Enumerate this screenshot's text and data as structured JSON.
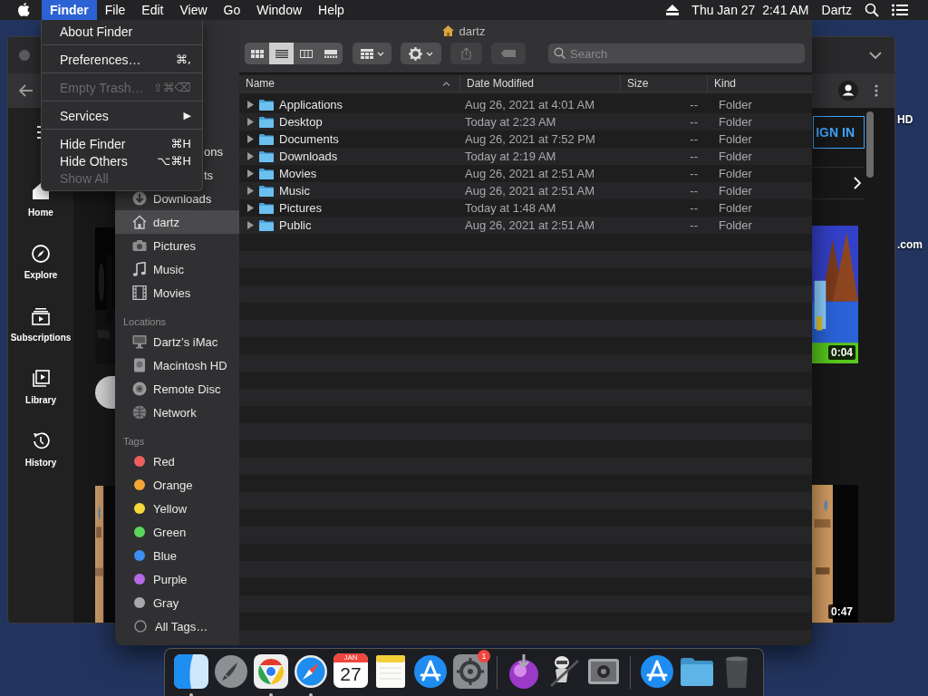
{
  "desktop": {
    "labels": [
      {
        "text": "HD"
      },
      {
        "text": ".com"
      }
    ]
  },
  "menu_bar": {
    "menus": [
      {
        "label": "Finder",
        "selected": true
      },
      {
        "label": "File",
        "selected": false
      },
      {
        "label": "Edit",
        "selected": false
      },
      {
        "label": "View",
        "selected": false
      },
      {
        "label": "Go",
        "selected": false
      },
      {
        "label": "Window",
        "selected": false
      },
      {
        "label": "Help",
        "selected": false
      }
    ],
    "clock": "Thu Jan 27  2:41 AM",
    "user": "Dartz"
  },
  "app_menu": {
    "items": [
      {
        "kind": "item",
        "label": "About Finder",
        "disabled": false
      },
      {
        "kind": "separator"
      },
      {
        "kind": "item",
        "label": "Preferences…",
        "shortcut": "⌘,",
        "disabled": false
      },
      {
        "kind": "separator"
      },
      {
        "kind": "item",
        "label": "Empty Trash…",
        "shortcut": "⇧⌘⌫",
        "disabled": true
      },
      {
        "kind": "separator"
      },
      {
        "kind": "submenu",
        "label": "Services",
        "arrow": "▶",
        "disabled": false
      },
      {
        "kind": "separator"
      },
      {
        "kind": "item",
        "label": "Hide Finder",
        "shortcut": "⌘H",
        "disabled": false
      },
      {
        "kind": "item",
        "label": "Hide Others",
        "shortcut": "⌥⌘H",
        "disabled": false
      },
      {
        "kind": "item",
        "label": "Show All",
        "disabled": true
      }
    ]
  },
  "browser": {
    "nav": [
      {
        "kind": "home",
        "label": "Home"
      },
      {
        "kind": "explore",
        "label": "Explore"
      },
      {
        "kind": "subscriptions",
        "label": "Subscriptions"
      },
      {
        "kind": "library",
        "label": "Library"
      },
      {
        "kind": "history",
        "label": "History"
      }
    ],
    "sign_in": "IGN IN",
    "videos": [
      {
        "kind": "picture",
        "duration": "0:04"
      },
      {
        "kind": "picture",
        "duration": "0:47"
      }
    ]
  },
  "finder": {
    "title": "dartz",
    "views": [
      {
        "kind": "icons",
        "selected": false
      },
      {
        "kind": "list",
        "selected": true
      },
      {
        "kind": "columns",
        "selected": false
      },
      {
        "kind": "gallery",
        "selected": false
      }
    ],
    "search": {
      "placeholder": "Search"
    },
    "sidebar": {
      "favorites": [
        {
          "kind": "clipped",
          "label": "ons",
          "selected": false
        },
        {
          "kind": "clipped",
          "label": "ts",
          "selected": false
        },
        {
          "kind": "downloads",
          "label": "Downloads",
          "selected": false
        },
        {
          "kind": "home",
          "label": "dartz",
          "selected": true
        },
        {
          "kind": "camera",
          "label": "Pictures",
          "selected": false
        },
        {
          "kind": "music",
          "label": "Music",
          "selected": false
        },
        {
          "kind": "film",
          "label": "Movies",
          "selected": false
        }
      ],
      "locations_heading": "Locations",
      "locations": [
        {
          "kind": "computer",
          "label": "Dartz’s iMac",
          "selected": false
        },
        {
          "kind": "disk",
          "label": "Macintosh HD",
          "selected": false
        },
        {
          "kind": "disc",
          "label": "Remote Disc",
          "selected": false
        },
        {
          "kind": "network",
          "label": "Network",
          "selected": false
        }
      ],
      "tags_heading": "Tags",
      "tags": [
        {
          "label": "Red",
          "color": "#ec5f5d"
        },
        {
          "label": "Orange",
          "color": "#f3a536"
        },
        {
          "label": "Yellow",
          "color": "#f5d83a"
        },
        {
          "label": "Green",
          "color": "#5cd65c"
        },
        {
          "label": "Blue",
          "color": "#3d8ef0"
        },
        {
          "label": "Purple",
          "color": "#b56be6"
        },
        {
          "label": "Gray",
          "color": "#a9a9ab"
        }
      ],
      "all_tags": "All Tags…"
    },
    "columns": [
      {
        "label": "Name",
        "sorted": true
      },
      {
        "label": "Date Modified",
        "sorted": false
      },
      {
        "label": "Size",
        "sorted": false
      },
      {
        "label": "Kind",
        "sorted": false
      }
    ],
    "rows": [
      {
        "name": "Applications",
        "date": "Aug 26, 2021 at 4:01 AM",
        "size": "--",
        "kind": "Folder"
      },
      {
        "name": "Desktop",
        "date": "Today at 2:23 AM",
        "size": "--",
        "kind": "Folder"
      },
      {
        "name": "Documents",
        "date": "Aug 26, 2021 at 7:52 PM",
        "size": "--",
        "kind": "Folder"
      },
      {
        "name": "Downloads",
        "date": "Today at 2:19 AM",
        "size": "--",
        "kind": "Folder"
      },
      {
        "name": "Movies",
        "date": "Aug 26, 2021 at 2:51 AM",
        "size": "--",
        "kind": "Folder"
      },
      {
        "name": "Music",
        "date": "Aug 26, 2021 at 2:51 AM",
        "size": "--",
        "kind": "Folder"
      },
      {
        "name": "Pictures",
        "date": "Today at 1:48 AM",
        "size": "--",
        "kind": "Folder"
      },
      {
        "name": "Public",
        "date": "Aug 26, 2021 at 2:51 AM",
        "size": "--",
        "kind": "Folder"
      }
    ]
  },
  "dock": {
    "items": [
      {
        "kind": "finder",
        "running": true
      },
      {
        "kind": "launchpad",
        "running": false
      },
      {
        "kind": "chrome",
        "running": true
      },
      {
        "kind": "safari",
        "running": true
      },
      {
        "kind": "calendar",
        "running": false,
        "month": "JAN",
        "day": "27"
      },
      {
        "kind": "notes",
        "running": false
      },
      {
        "kind": "appstore",
        "running": false
      },
      {
        "kind": "settings",
        "running": false,
        "badge": "1"
      },
      {
        "kind": "separator"
      },
      {
        "kind": "download",
        "running": false
      },
      {
        "kind": "robot",
        "running": false
      },
      {
        "kind": "camera",
        "running": false
      },
      {
        "kind": "separator"
      },
      {
        "kind": "appstore",
        "running": false
      },
      {
        "kind": "folder",
        "running": false
      },
      {
        "kind": "trash",
        "running": false
      }
    ]
  }
}
